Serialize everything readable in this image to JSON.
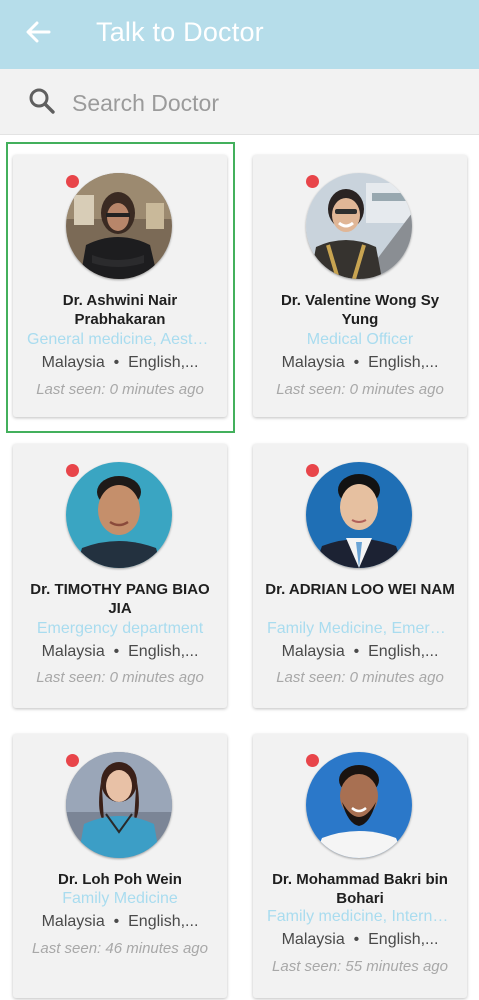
{
  "header": {
    "title": "Talk to Doctor",
    "back_icon": "arrow-left-icon",
    "background": "#b6ddea"
  },
  "search": {
    "placeholder": "Search Doctor",
    "value": "",
    "icon": "search-icon"
  },
  "doctors": [
    {
      "name": "Dr. Ashwini Nair Prabhakaran",
      "specialty": "General medicine, Aesthetic medicine",
      "location": "Malaysia",
      "languages": "English, Malay, Tamil",
      "last_seen": "Last seen: 0 minutes ago",
      "status": "offline",
      "selected": true
    },
    {
      "name": "Dr. Valentine Wong Sy Yung",
      "specialty": "Medical Officer",
      "location": "Malaysia",
      "languages": "English, Malay, Chinese",
      "last_seen": "Last seen: 0 minutes ago",
      "status": "offline",
      "selected": false
    },
    {
      "name": "Dr. TIMOTHY PANG BIAO JIA",
      "specialty": "Emergency department",
      "location": "Malaysia",
      "languages": "English, Malay, Chinese",
      "last_seen": "Last seen: 0 minutes ago",
      "status": "offline",
      "selected": false
    },
    {
      "name": "Dr. ADRIAN LOO WEI NAM",
      "specialty": "Family Medicine, Emergency",
      "location": "Malaysia",
      "languages": "English, Malay, Chinese",
      "last_seen": "Last seen: 0 minutes ago",
      "status": "offline",
      "selected": false
    },
    {
      "name": "Dr. Loh Poh Wein",
      "specialty": "Family Medicine",
      "location": "Malaysia",
      "languages": "English, Malay, Chinese",
      "last_seen": "Last seen: 46 minutes ago",
      "status": "offline",
      "selected": false
    },
    {
      "name": "Dr. Mohammad Bakri bin Bohari",
      "specialty": "Family medicine, Internal medicine",
      "location": "Malaysia",
      "languages": "English, Malay",
      "last_seen": "Last seen: 55 minutes ago",
      "status": "offline",
      "selected": false
    }
  ],
  "colors": {
    "specialty": "#a9dcef",
    "status_dot": "#e8454a",
    "selection": "#43b05c"
  }
}
